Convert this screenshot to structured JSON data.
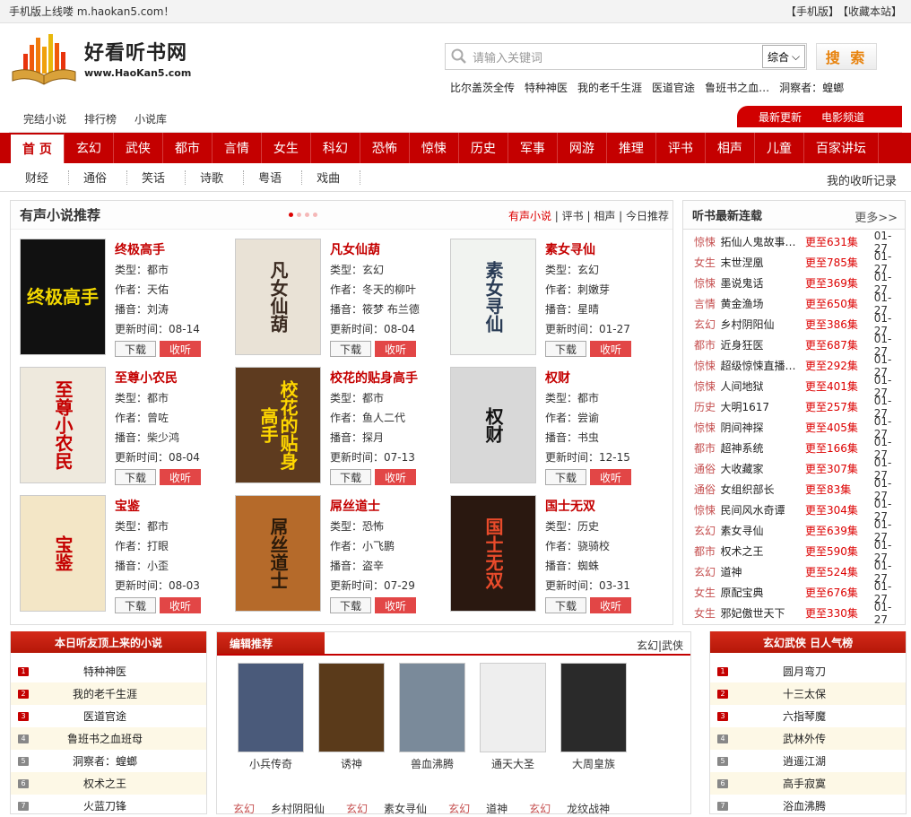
{
  "topbar": {
    "left": "手机版上线喽 m.haokan5.com！",
    "mobile": "【手机版】",
    "fav": "【收藏本站】"
  },
  "logo": {
    "cn": "好看听书网",
    "en": "www.HaoKan5.com"
  },
  "search": {
    "placeholder": "请输入关键词",
    "select": "综合",
    "button": "搜 索"
  },
  "hot": [
    "比尔盖茨全传",
    "特种神医",
    "我的老千生涯",
    "医道官途",
    "鲁班书之血…",
    "洞察者：蝗螂"
  ],
  "subnav": {
    "left": [
      "完结小说",
      "排行榜",
      "小说库"
    ],
    "right": [
      "最新更新",
      "电影频道"
    ]
  },
  "mainnav": [
    "首 页",
    "玄幻",
    "武侠",
    "都市",
    "言情",
    "女生",
    "科幻",
    "恐怖",
    "惊悚",
    "历史",
    "军事",
    "网游",
    "推理",
    "评书",
    "相声",
    "儿童",
    "百家讲坛"
  ],
  "catnav": {
    "items": [
      "财经",
      "通俗",
      "笑话",
      "诗歌",
      "粤语",
      "戏曲"
    ],
    "record": "我的收听记录"
  },
  "recommend": {
    "title": "有声小说推荐",
    "links_red": "有声小说",
    "links": "| 评书 | 相声 | 今日推荐",
    "labels": {
      "type": "类型：",
      "author": "作者：",
      "anchor": "播音：",
      "update": "更新时间：",
      "download": "下载",
      "listen": "收听"
    },
    "books": [
      {
        "title": "终极高手",
        "type": "都市",
        "author": "天佑",
        "anchor": "刘涛",
        "update": "08-14",
        "cover_text": "终极高手",
        "bg": "#111",
        "fg": "#f3d800"
      },
      {
        "title": "凡女仙葫",
        "type": "玄幻",
        "author": "冬天的柳叶",
        "anchor": "筱梦 布兰德",
        "update": "08-04",
        "cover_text": "凡女仙葫",
        "bg": "#e9e2d6",
        "fg": "#3a2a20"
      },
      {
        "title": "素女寻仙",
        "type": "玄幻",
        "author": "刺嫩芽",
        "anchor": "星晴",
        "update": "01-27",
        "cover_text": "素女寻仙",
        "bg": "#f1f3f0",
        "fg": "#293b55"
      },
      {
        "title": "至尊小农民",
        "type": "都市",
        "author": "曾咗",
        "anchor": "柴少鸿",
        "update": "08-04",
        "cover_text": "至尊小农民",
        "bg": "#eee9dd",
        "fg": "#c40000"
      },
      {
        "title": "校花的贴身高手",
        "type": "都市",
        "author": "鱼人二代",
        "anchor": "探月",
        "update": "07-13",
        "cover_text": "校花的贴身高手",
        "bg": "#5e3b1f",
        "fg": "#ffd700"
      },
      {
        "title": "权财",
        "type": "都市",
        "author": "尝谕",
        "anchor": "书虫",
        "update": "12-15",
        "cover_text": "权财",
        "bg": "#d8d8d8",
        "fg": "#111"
      },
      {
        "title": "宝鉴",
        "type": "都市",
        "author": "打眼",
        "anchor": "小歪",
        "update": "08-03",
        "cover_text": "宝鉴",
        "bg": "#f3e6c6",
        "fg": "#c40000"
      },
      {
        "title": "屌丝道士",
        "type": "恐怖",
        "author": "小飞鹏",
        "anchor": "盗辛",
        "update": "07-29",
        "cover_text": "屌丝道士",
        "bg": "#b56a2a",
        "fg": "#2a1a0a"
      },
      {
        "title": "国士无双",
        "type": "历史",
        "author": "骁骑校",
        "anchor": "蜘蛛",
        "update": "03-31",
        "cover_text": "国士无双",
        "bg": "#2a1810",
        "fg": "#e94b2b"
      }
    ]
  },
  "serial": {
    "title": "听书最新连载",
    "more": "更多>>",
    "rows": [
      {
        "g": "惊悚",
        "n": "拓仙人鬼故事…",
        "u": "更至631集",
        "d": "01-27"
      },
      {
        "g": "女生",
        "n": "末世涅凰",
        "u": "更至785集",
        "d": "01-27"
      },
      {
        "g": "惊悚",
        "n": "墨说鬼话",
        "u": "更至369集",
        "d": "01-27"
      },
      {
        "g": "言情",
        "n": "黄金渔场",
        "u": "更至650集",
        "d": "01-27"
      },
      {
        "g": "玄幻",
        "n": "乡村阴阳仙",
        "u": "更至386集",
        "d": "01-27"
      },
      {
        "g": "都市",
        "n": "近身狂医",
        "u": "更至687集",
        "d": "01-27"
      },
      {
        "g": "惊悚",
        "n": "超级惊悚直播…",
        "u": "更至292集",
        "d": "01-27"
      },
      {
        "g": "惊悚",
        "n": "人间地狱",
        "u": "更至401集",
        "d": "01-27"
      },
      {
        "g": "历史",
        "n": "大明1617",
        "u": "更至257集",
        "d": "01-27"
      },
      {
        "g": "惊悚",
        "n": "阴间神探",
        "u": "更至405集",
        "d": "01-27"
      },
      {
        "g": "都市",
        "n": "超神系统",
        "u": "更至166集",
        "d": "01-27"
      },
      {
        "g": "通俗",
        "n": "大收藏家",
        "u": "更至307集",
        "d": "01-27"
      },
      {
        "g": "通俗",
        "n": "女组织部长",
        "u": "更至83集",
        "d": "01-27"
      },
      {
        "g": "惊悚",
        "n": "民间风水奇谭",
        "u": "更至304集",
        "d": "01-27"
      },
      {
        "g": "玄幻",
        "n": "素女寻仙",
        "u": "更至639集",
        "d": "01-27"
      },
      {
        "g": "都市",
        "n": "权术之王",
        "u": "更至590集",
        "d": "01-27"
      },
      {
        "g": "玄幻",
        "n": "道神",
        "u": "更至524集",
        "d": "01-27"
      },
      {
        "g": "女生",
        "n": "原配宝典",
        "u": "更至676集",
        "d": "01-27"
      },
      {
        "g": "女生",
        "n": "邪妃傲世天下",
        "u": "更至330集",
        "d": "01-27"
      }
    ]
  },
  "today_top": {
    "title": "本日听友顶上来的小说",
    "items": [
      "特种神医",
      "我的老千生涯",
      "医道官途",
      "鲁班书之血班母",
      "洞察者：蝗螂",
      "权术之王",
      "火蓝刀锋"
    ]
  },
  "editor": {
    "title": "编辑推荐",
    "tabs": "玄幻|武侠",
    "books": [
      {
        "title": "小兵传奇",
        "bg": "#4a5a7a",
        "fg": "#fff"
      },
      {
        "title": "诱神",
        "bg": "#5a3a1a",
        "fg": "#e8b830"
      },
      {
        "title": "兽血沸腾",
        "bg": "#7a8a9a",
        "fg": "#fff"
      },
      {
        "title": "通天大圣",
        "bg": "#eee",
        "fg": "#222"
      },
      {
        "title": "大周皇族",
        "bg": "#2a2a2a",
        "fg": "#d00"
      }
    ],
    "links": [
      {
        "g": "玄幻",
        "n": "乡村阴阳仙"
      },
      {
        "g": "玄幻",
        "n": "素女寻仙"
      },
      {
        "g": "玄幻",
        "n": "道神"
      },
      {
        "g": "玄幻",
        "n": "龙纹战神"
      }
    ]
  },
  "popular": {
    "title": "玄幻武侠 日人气榜",
    "items": [
      "圆月弯刀",
      "十三太保",
      "六指琴魔",
      "武林外传",
      "逍遥江湖",
      "高手寂寞",
      "浴血沸腾"
    ]
  }
}
